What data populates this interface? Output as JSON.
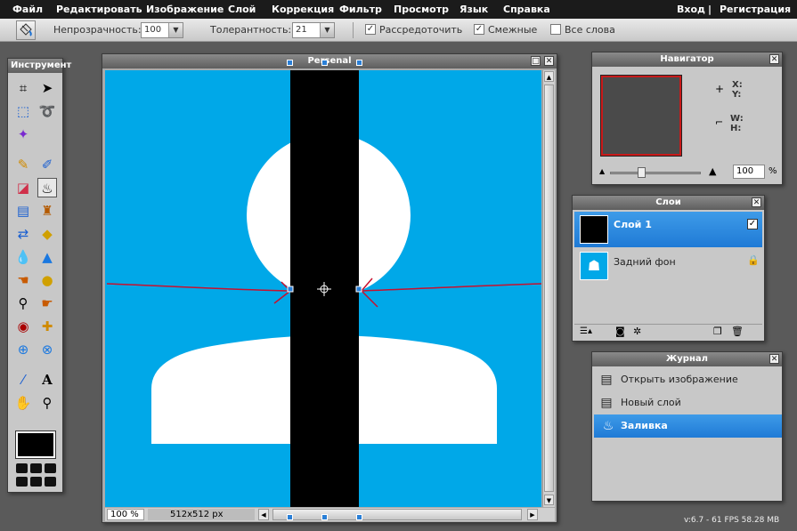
{
  "menubar": {
    "items": [
      "Файл",
      "Редактировать",
      "Изображение",
      "Слой",
      "Коррекция",
      "Фильтр",
      "Просмотр",
      "Язык",
      "Справка"
    ],
    "login": "Вход",
    "separator": "|",
    "register": "Регистрация"
  },
  "toolbar": {
    "opacity_label": "Непрозрачность:",
    "opacity_value": "100",
    "tolerance_label": "Толерантность:",
    "tolerance_value": "21",
    "antialias_label": "Рассредоточить",
    "antialias_checked": true,
    "contiguous_label": "Смежные",
    "contiguous_checked": true,
    "alllayers_label": "Все слова",
    "alllayers_checked": false
  },
  "tools_panel": {
    "title": "Инструмент",
    "icons": [
      "crop-icon",
      "move-icon",
      "marquee-icon",
      "lasso-icon",
      "magic-wand-icon",
      "pencil-icon",
      "brush-icon",
      "eraser-icon",
      "paint-bucket-icon",
      "gradient-icon",
      "stamp-icon",
      "color-replace-icon",
      "shape-icon",
      "blur-icon",
      "sharpen-icon",
      "smudge-icon",
      "sponge-icon",
      "burn-icon",
      "dodge-icon",
      "red-eye-icon",
      "spot-heal-icon",
      "bloat-icon",
      "pinch-icon",
      "color-picker-icon",
      "text-icon",
      "hand-icon",
      "zoom-icon"
    ]
  },
  "document": {
    "title": "Persenal",
    "zoom": "100 %",
    "size": "512x512 px",
    "colors": {
      "background": "#00a8e8",
      "figure": "#ffffff",
      "layer": "#000000",
      "annotation": "#c8102e"
    }
  },
  "navigator": {
    "title": "Навигатор",
    "x_label": "X:",
    "y_label": "Y:",
    "w_label": "W:",
    "h_label": "H:",
    "zoom_value": "100",
    "zoom_unit": "%"
  },
  "layers": {
    "title": "Слои",
    "items": [
      {
        "name": "Слой 1",
        "selected": true,
        "visible_checked": true
      },
      {
        "name": "Задний фон",
        "selected": false,
        "locked": true
      }
    ]
  },
  "history": {
    "title": "Журнал",
    "items": [
      {
        "label": "Открыть изображение",
        "icon": "document-icon",
        "selected": false
      },
      {
        "label": "Новый слой",
        "icon": "document-icon",
        "selected": false
      },
      {
        "label": "Заливка",
        "icon": "paint-bucket-icon",
        "selected": true
      }
    ]
  },
  "status": {
    "version": "v:6.7 - 61 FPS 58.28 MB"
  },
  "close_glyph": "✕"
}
